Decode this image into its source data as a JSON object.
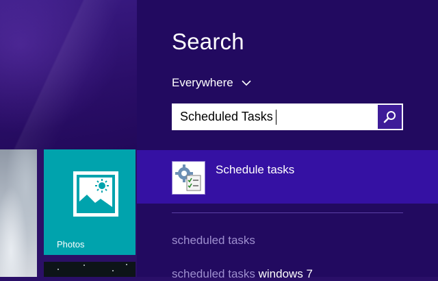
{
  "start_screen": {
    "photos_tile_label": "Photos"
  },
  "search": {
    "title": "Search",
    "scope_label": "Everywhere",
    "query": "Scheduled Tasks",
    "top_result": {
      "label": "Schedule tasks"
    },
    "suggestions": [
      {
        "base": "scheduled tasks",
        "extra": ""
      },
      {
        "base": "scheduled tasks",
        "extra": " windows 7"
      }
    ]
  },
  "colors": {
    "pane_background": "#220a60",
    "selected_result": "#3511a3",
    "search_button": "#3e1c98",
    "photos_tile": "#00a3ad"
  },
  "icons": {
    "search_button": "magnifier-icon",
    "scope_dropdown": "chevron-down-icon",
    "result": "task-scheduler-icon",
    "photos_tile": "photo-icon"
  }
}
